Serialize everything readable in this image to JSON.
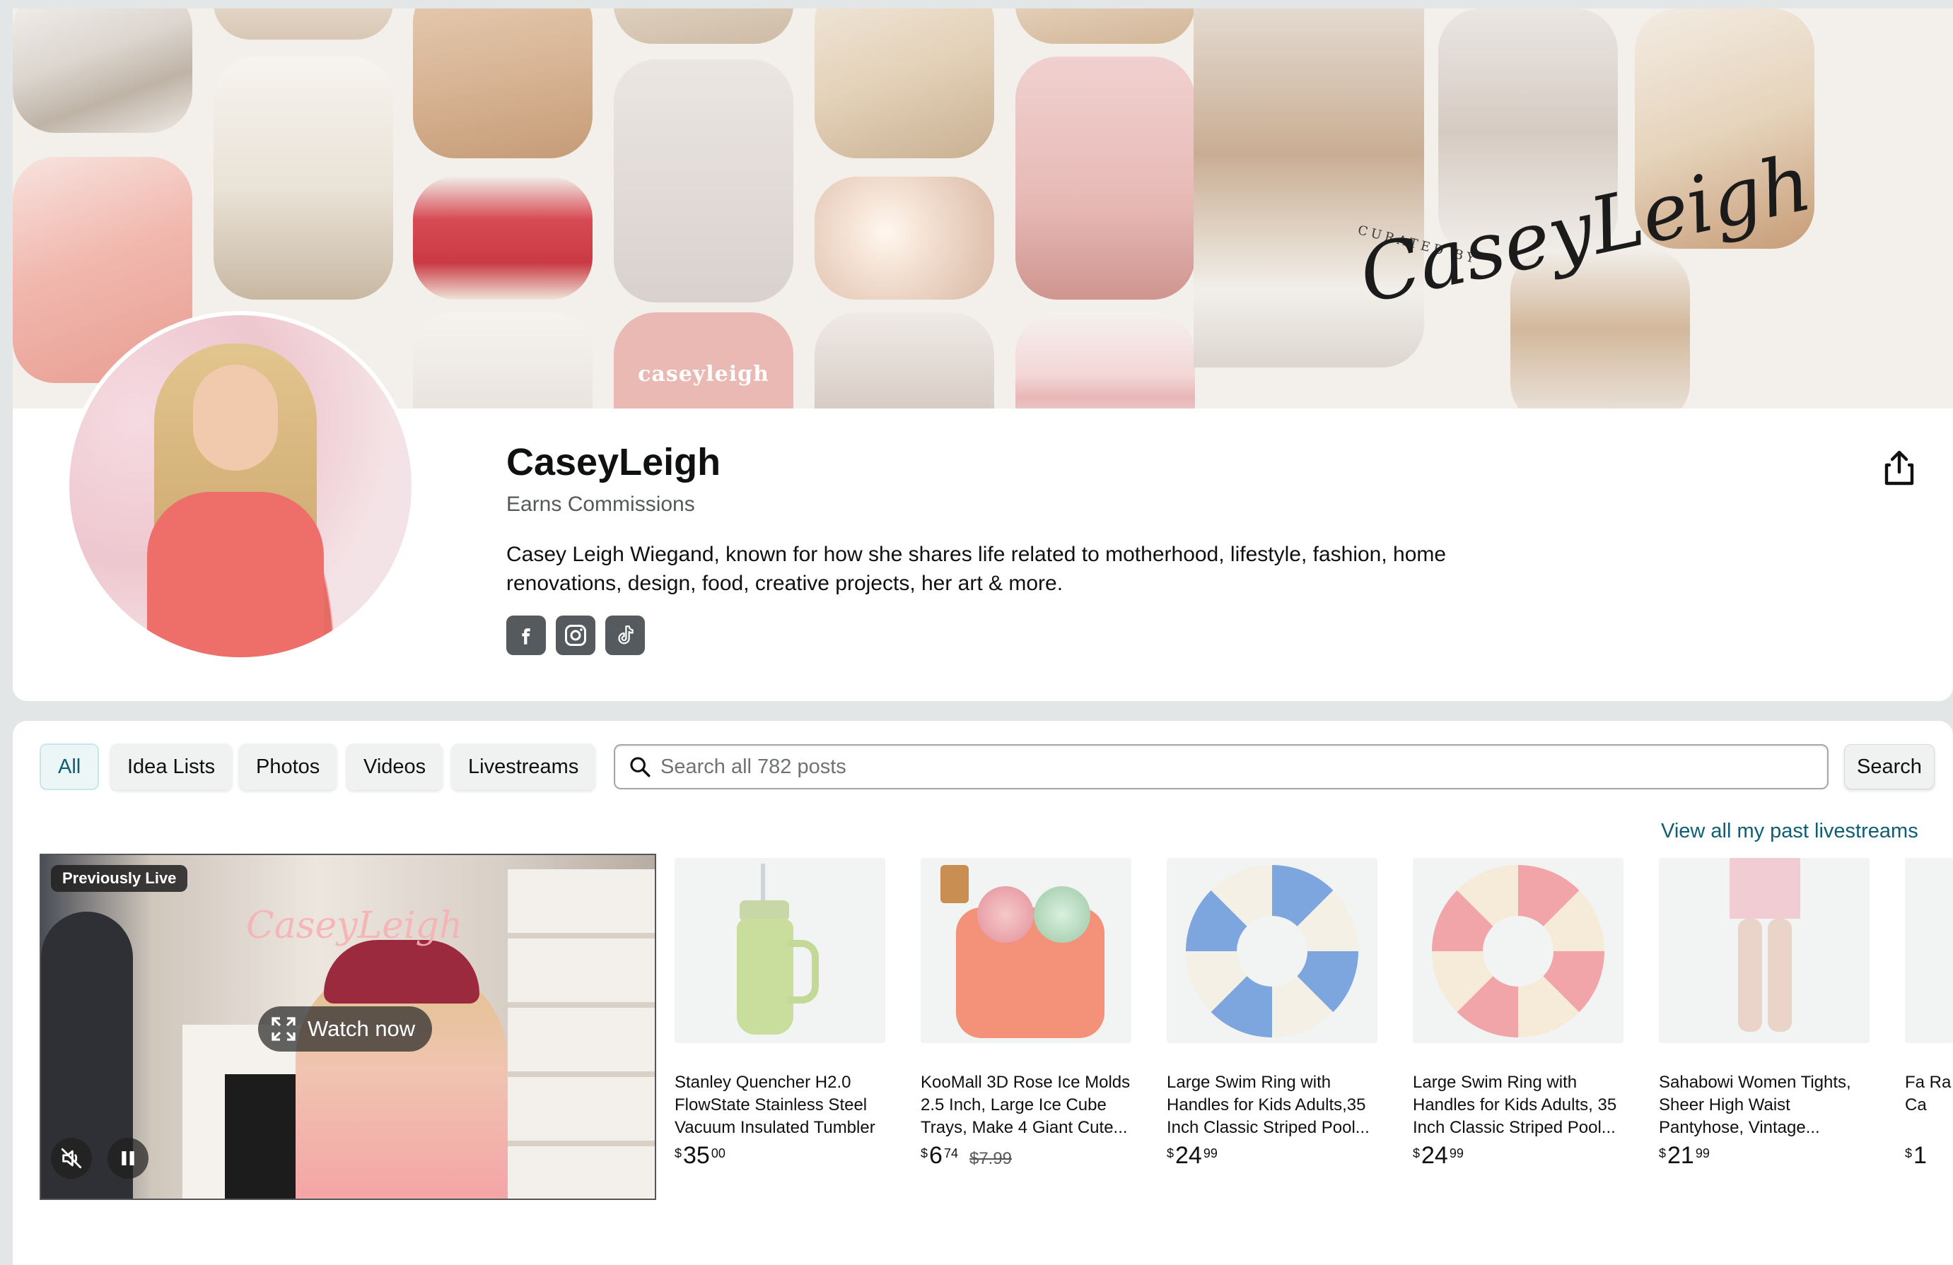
{
  "banner": {
    "logo_tile_text": "caseyleigh",
    "script_text": "CaseyLeigh",
    "curated_text": "CURATED BY"
  },
  "profile": {
    "name": "CaseyLeigh",
    "earns": "Earns Commissions",
    "bio": "Casey Leigh Wiegand, known for how she shares life related to motherhood, lifestyle, fashion, home renovations, design, food, creative projects, her art & more.",
    "socials": [
      "facebook-icon",
      "instagram-icon",
      "tiktok-icon"
    ]
  },
  "filters": {
    "all": "All",
    "idea_lists": "Idea Lists",
    "photos": "Photos",
    "videos": "Videos",
    "livestreams": "Livestreams"
  },
  "search": {
    "placeholder": "Search all 782 posts",
    "button": "Search"
  },
  "livestreams": {
    "view_all": "View all my past livestreams",
    "badge": "Previously Live",
    "watch_now": "Watch now",
    "neon": "CaseyLeigh"
  },
  "products": [
    {
      "title": "Stanley Quencher H2.0 FlowState Stainless Steel Vacuum Insulated Tumbler",
      "currency": "$",
      "whole": "35",
      "fraction": "00",
      "list_price": ""
    },
    {
      "title": "KooMall 3D Rose Ice Molds 2.5 Inch, Large Ice Cube Trays, Make 4 Giant Cute...",
      "currency": "$",
      "whole": "6",
      "fraction": "74",
      "list_price": "$7.99"
    },
    {
      "title": "Large Swim Ring with Handles for Kids Adults,35 Inch Classic Striped Pool...",
      "currency": "$",
      "whole": "24",
      "fraction": "99",
      "list_price": ""
    },
    {
      "title": "Large Swim Ring with Handles for Kids Adults, 35 Inch Classic Striped Pool...",
      "currency": "$",
      "whole": "24",
      "fraction": "99",
      "list_price": ""
    },
    {
      "title": "Sahabowi Women Tights, Sheer High Waist Pantyhose, Vintage...",
      "currency": "$",
      "whole": "21",
      "fraction": "99",
      "list_price": ""
    }
  ],
  "edge_product": {
    "title": "Fa Ra Ca",
    "currency": "$",
    "whole": "1"
  },
  "colors": {
    "accent_teal": "#0e5f73",
    "background": "#e3e6e6",
    "card": "#ffffff"
  }
}
